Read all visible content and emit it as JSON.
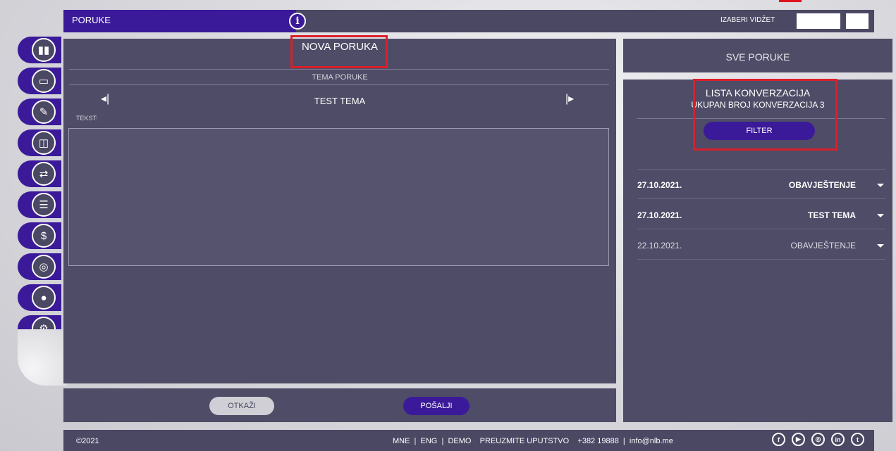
{
  "header": {
    "section_title": "PORUKE",
    "info_icon": "i",
    "widget_label": "IZABERI VIDŽET"
  },
  "sidebar": {
    "items": [
      {
        "icon": "bar-chart-icon",
        "glyph": "▮▮"
      },
      {
        "icon": "card-icon",
        "glyph": "▭"
      },
      {
        "icon": "signature-icon",
        "glyph": "✎"
      },
      {
        "icon": "devices-icon",
        "glyph": "◫"
      },
      {
        "icon": "transfer-icon",
        "glyph": "⇄"
      },
      {
        "icon": "list-icon",
        "glyph": "☰"
      },
      {
        "icon": "dollar-icon",
        "glyph": "$"
      },
      {
        "icon": "coins-icon",
        "glyph": "◎"
      },
      {
        "icon": "location-icon",
        "glyph": "●"
      },
      {
        "icon": "gear-icon",
        "glyph": "⚙"
      }
    ]
  },
  "compose": {
    "title": "NOVA PORUKA",
    "topic_label": "TEMA PORUKE",
    "topic_value": "TEST TEMA",
    "topic_prev": "◂|",
    "topic_next": "|▸",
    "text_label": "TEKST:",
    "text_value": "",
    "cancel_label": "OTKAŽI",
    "send_label": "POŠALJI"
  },
  "conversations": {
    "all_messages_label": "SVE PORUKE",
    "list_title": "LISTA KONVERZACIJA",
    "count_text": "UKUPAN BROJ KONVERZACIJA 3",
    "filter_label": "FILTER",
    "items": [
      {
        "date": "27.10.2021.",
        "subject": "OBAVJEŠTENJE",
        "unread": true
      },
      {
        "date": "27.10.2021.",
        "subject": "TEST TEMA",
        "unread": true
      },
      {
        "date": "22.10.2021.",
        "subject": "OBAVJEŠTENJE",
        "unread": false
      }
    ]
  },
  "footer": {
    "copyright": "©2021",
    "links": "MNE  |  ENG  |  DEMO    PREUZMITE UPUTSTVO    +382 19888  |  info@nlb.me",
    "social": [
      {
        "icon": "facebook-icon",
        "glyph": "f"
      },
      {
        "icon": "youtube-icon",
        "glyph": "▶"
      },
      {
        "icon": "instagram-icon",
        "glyph": "◎"
      },
      {
        "icon": "linkedin-icon",
        "glyph": "in"
      },
      {
        "icon": "twitter-icon",
        "glyph": "t"
      }
    ]
  },
  "colors": {
    "brand_purple": "#3b1a9a",
    "panel": "#4e4c66",
    "highlight_red": "#d9202a"
  }
}
